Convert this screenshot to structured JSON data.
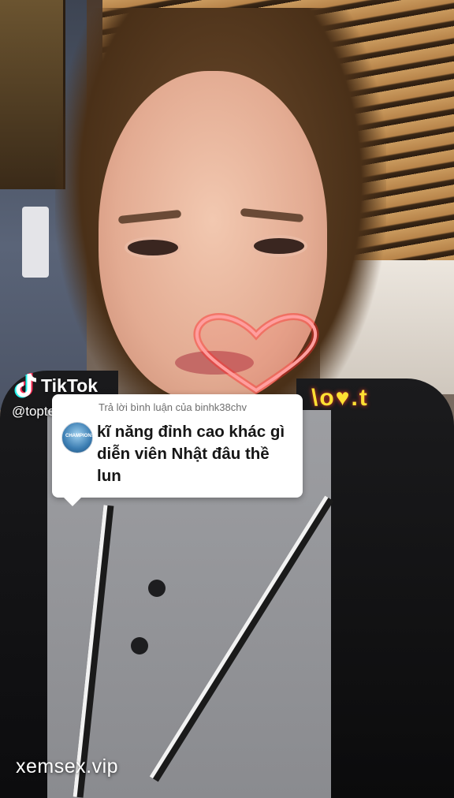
{
  "tiktok": {
    "brand_label": "TikTok",
    "handle": "@topteseverol",
    "logo_icon": "tiktok-note-icon"
  },
  "reply": {
    "header": "Trả lời bình luận của binhk38chv",
    "comment": "kĩ năng đỉnh cao khác gì diễn viên Nhật đâu thề lun",
    "avatar_icon": "commenter-avatar"
  },
  "site_watermark": "xemsex.vip",
  "decoration": {
    "heart_icon": "neon-heart-icon",
    "heart_color": "#ff2a2a",
    "neon_text_fragment": "\\o♥.t"
  }
}
